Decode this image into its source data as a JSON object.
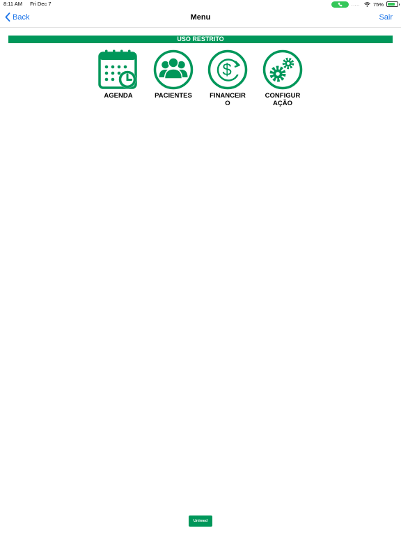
{
  "status_bar": {
    "time": "8:11 AM",
    "date": "Fri Dec 7",
    "signal": ".....",
    "battery": "75%",
    "battery_level": 0.75
  },
  "nav": {
    "back_label": "Back",
    "title": "Menu",
    "sair_label": "Sair"
  },
  "banner": "USO RESTRITO",
  "menu": [
    {
      "label": "AGENDA",
      "icon": "calendar-clock-icon"
    },
    {
      "label": "PACIENTES",
      "icon": "patients-group-icon"
    },
    {
      "label": "FINANCEIRO",
      "icon": "money-cycle-icon"
    },
    {
      "label": "CONFIGURAÇÃO",
      "icon": "gears-icon"
    }
  ],
  "footer": {
    "logo_text": "Unimed"
  },
  "colors": {
    "brand_green": "#00975a",
    "link_blue": "#1a73e8",
    "call_green": "#34c759"
  }
}
